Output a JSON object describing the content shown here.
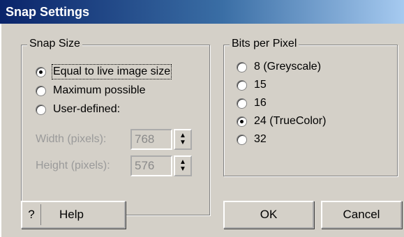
{
  "window": {
    "title": "Snap Settings"
  },
  "snap_size": {
    "legend": "Snap Size",
    "options": [
      {
        "label": "Equal to live image size",
        "selected": true
      },
      {
        "label": "Maximum possible",
        "selected": false
      },
      {
        "label": "User-defined:",
        "selected": false
      }
    ],
    "width_label": "Width (pixels):",
    "width_value": "768",
    "height_label": "Height (pixels):",
    "height_value": "576"
  },
  "bits_per_pixel": {
    "legend": "Bits per Pixel",
    "options": [
      {
        "label": "8 (Greyscale)",
        "selected": false
      },
      {
        "label": "15",
        "selected": false
      },
      {
        "label": "16",
        "selected": false
      },
      {
        "label": "24 (TrueColor)",
        "selected": true
      },
      {
        "label": "32",
        "selected": false
      }
    ]
  },
  "buttons": {
    "help_icon": "?",
    "help": "Help",
    "ok": "OK",
    "cancel": "Cancel"
  }
}
